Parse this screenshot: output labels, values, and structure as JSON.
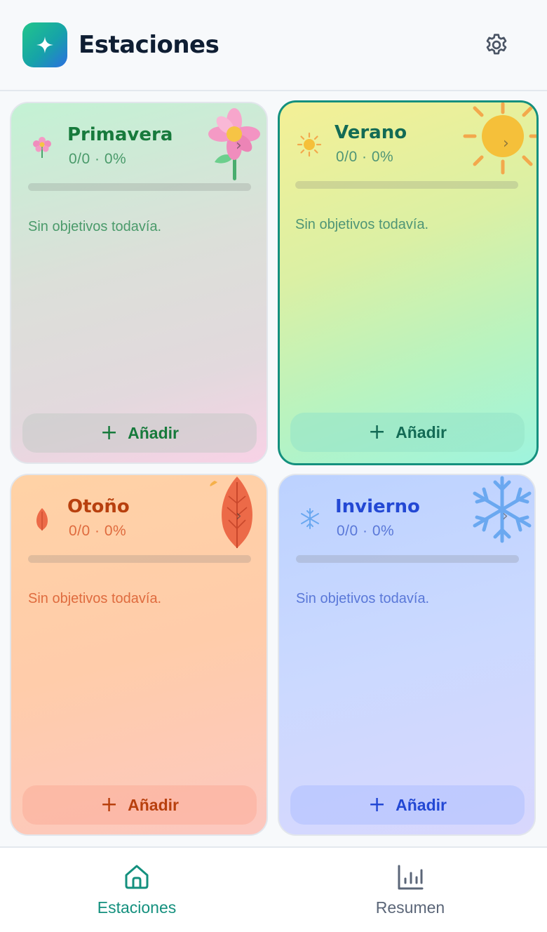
{
  "app": {
    "title": "Estaciones",
    "logo_icon": "sparkle-icon",
    "settings_icon": "gear-icon"
  },
  "colors": {
    "accent": "#14907e",
    "spring": "#177a3c",
    "summer": "#136b55",
    "autumn": "#b8400e",
    "winter": "#2348d4"
  },
  "seasons": [
    {
      "key": "spring",
      "name": "Primavera",
      "count": "0/0 · 0%",
      "progress": 0,
      "empty": "Sin objetivos todavía.",
      "add_label": "Añadir",
      "icon": "flower-icon",
      "selected": false
    },
    {
      "key": "summer",
      "name": "Verano",
      "count": "0/0 · 0%",
      "progress": 0,
      "empty": "Sin objetivos todavía.",
      "add_label": "Añadir",
      "icon": "sun-icon",
      "selected": true
    },
    {
      "key": "autumn",
      "name": "Otoño",
      "count": "0/0 · 0%",
      "progress": 0,
      "empty": "Sin objetivos todavía.",
      "add_label": "Añadir",
      "icon": "leaf-icon",
      "selected": false
    },
    {
      "key": "winter",
      "name": "Invierno",
      "count": "0/0 · 0%",
      "progress": 0,
      "empty": "Sin objetivos todavía.",
      "add_label": "Añadir",
      "icon": "snowflake-icon",
      "selected": false
    }
  ],
  "add_symbol": "+",
  "chevron": "›",
  "tabbar": {
    "tabs": [
      {
        "label": "Estaciones",
        "icon": "home-icon",
        "active": true
      },
      {
        "label": "Resumen",
        "icon": "bar-chart-icon",
        "active": false
      }
    ]
  }
}
